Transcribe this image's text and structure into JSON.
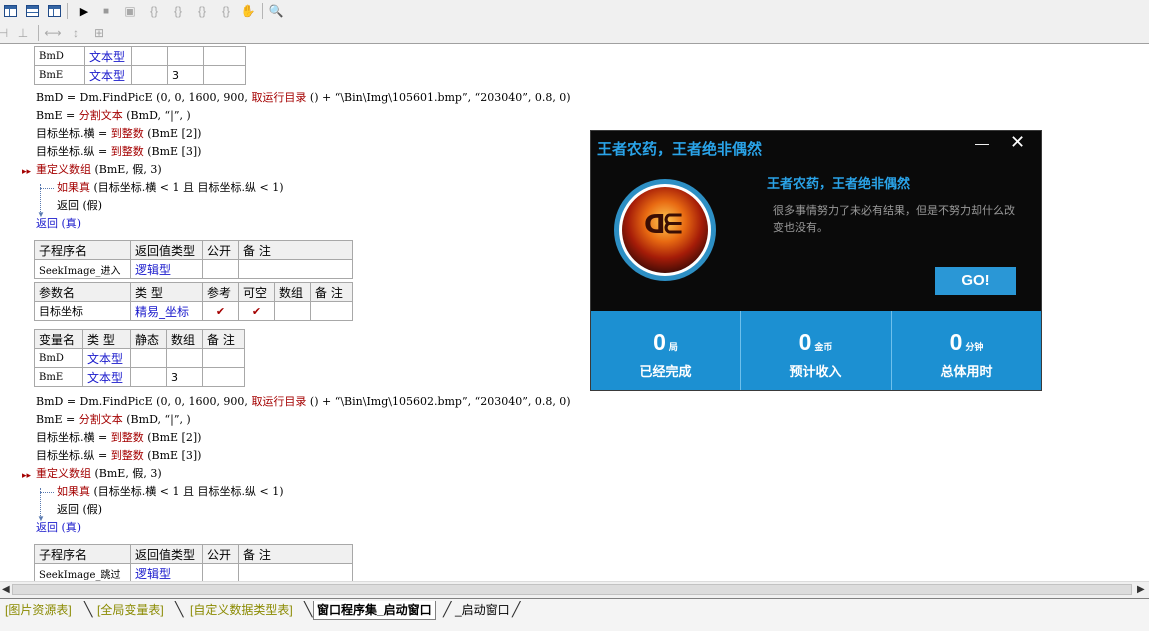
{
  "code": {
    "table_var1_rows": [
      {
        "name": "BmD",
        "type": "文本型",
        "static": "",
        "array": "",
        "note": ""
      },
      {
        "name": "BmE",
        "type": "文本型",
        "static": "",
        "array": "3",
        "note": ""
      }
    ],
    "block1": {
      "l1_a": "BmD = Dm.FindPicE (0, 0, 1600, 900, ",
      "l1_b": "取运行目录",
      "l1_c": " () + “\\Bin\\Img\\105601.bmp”, “203040”, 0.8, 0)",
      "l2_a": "BmE = ",
      "l2_b": "分割文本",
      "l2_c": " (BmD, “|”, )",
      "l3_a": "目标坐标.横 = ",
      "l3_b": "到整数",
      "l3_c": " (BmE [2])",
      "l4_a": "目标坐标.纵 = ",
      "l4_b": "到整数",
      "l4_c": " (BmE [3])",
      "l5_b": "重定义数组",
      "l5_c": " (BmE, 假, 3)",
      "l6_b": "如果真",
      "l6_c": " (目标坐标.横 < 1 且 目标坐标.纵 < 1)",
      "l7": "返回 (假)",
      "l8": "返回 (真)"
    },
    "sub1": {
      "headers": [
        "子程序名",
        "返回值类型",
        "公开",
        "备 注"
      ],
      "name": "SeekImage_进入",
      "ret": "逻辑型",
      "param_headers": [
        "参数名",
        "类 型",
        "参考",
        "可空",
        "数组",
        "备 注"
      ],
      "param_name": "目标坐标",
      "param_type": "精易_坐标",
      "check": "✔"
    },
    "var2_headers": [
      "变量名",
      "类 型",
      "静态",
      "数组",
      "备 注"
    ],
    "table_var2_rows": [
      {
        "name": "BmD",
        "type": "文本型",
        "array": ""
      },
      {
        "name": "BmE",
        "type": "文本型",
        "array": "3"
      }
    ],
    "block2": {
      "l1_a": "BmD = Dm.FindPicE (0, 0, 1600, 900, ",
      "l1_b": "取运行目录",
      "l1_c": " () + “\\Bin\\Img\\105602.bmp”, “203040”, 0.8, 0)",
      "l2_a": "BmE = ",
      "l2_b": "分割文本",
      "l2_c": " (BmD, “|”, )",
      "l3_a": "目标坐标.横 = ",
      "l3_b": "到整数",
      "l3_c": " (BmE [2])",
      "l4_a": "目标坐标.纵 = ",
      "l4_b": "到整数",
      "l4_c": " (BmE [3])",
      "l5_b": "重定义数组",
      "l5_c": " (BmE, 假, 3)",
      "l6_b": "如果真",
      "l6_c": " (目标坐标.横 < 1 且 目标坐标.纵 < 1)",
      "l7": "返回 (假)",
      "l8": "返回 (真)"
    },
    "sub2": {
      "headers": [
        "子程序名",
        "返回值类型",
        "公开",
        "备 注"
      ],
      "name": "SeekImage_跳过",
      "ret": "逻辑型"
    }
  },
  "popup": {
    "title": "王者农药，王者绝非偶然",
    "min_label": "—",
    "close_label": "✕",
    "heading": "王者农药，王者绝非偶然",
    "description": "很多事情努力了未必有结果，但是不努力却什么改变也没有。",
    "go_label": "GO!",
    "stats": [
      {
        "value": "0",
        "unit": "局",
        "label": "已经完成"
      },
      {
        "value": "0",
        "unit": "金币",
        "label": "预计收入"
      },
      {
        "value": "0",
        "unit": "分钟",
        "label": "总体用时"
      }
    ]
  },
  "tabs": [
    {
      "label": "[图片资源表]",
      "state": "olive"
    },
    {
      "label": "[全局变量表]",
      "state": "olive"
    },
    {
      "label": "[自定义数据类型表]",
      "state": "olive"
    },
    {
      "label": "窗口程序集_启动窗口",
      "state": "active"
    },
    {
      "label": "_启动窗口",
      "state": "normal"
    }
  ],
  "colors": {
    "popup_accent": "#2aa3e8",
    "stats_bar": "#1c90d2",
    "keyword_red": "#a40000",
    "type_blue": "#1a1acc"
  }
}
